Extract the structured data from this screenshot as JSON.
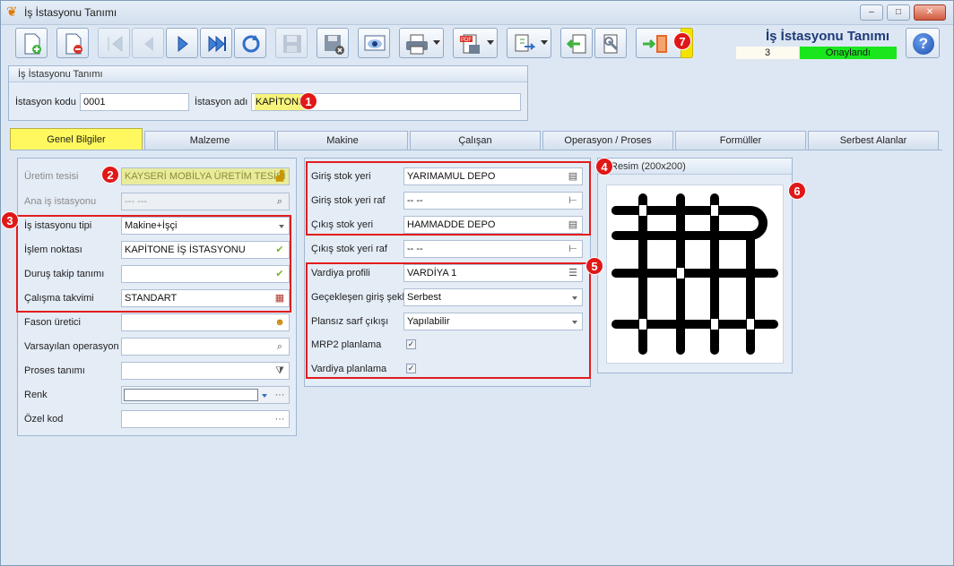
{
  "window": {
    "title": "İş İstasyonu Tanımı",
    "controls": {
      "minimize": "–",
      "maximize": "□",
      "close": "✕"
    }
  },
  "header": {
    "title": "İş İstasyonu Tanımı",
    "record_number": "3",
    "status": "Onaylandı",
    "status_color": "#19e61c"
  },
  "toolbar": {
    "buttons": [
      "new-icon",
      "delete-icon",
      "first-icon",
      "prev-icon",
      "next-icon",
      "last-icon",
      "refresh-icon",
      "save-icon",
      "save-close-icon",
      "preview-icon",
      "print-icon",
      "pdf-icon",
      "export-icon",
      "import-icon",
      "tools-icon",
      "exit-icon"
    ]
  },
  "station": {
    "group_title": "İş İstasyonu Tanımı",
    "code_label": "İstasyon kodu",
    "code_value": "0001",
    "name_label": "İstasyon adı",
    "name_value": "KAPİTONE"
  },
  "tabs": [
    "Genel Bilgiler",
    "Malzeme",
    "Makine",
    "Çalışan",
    "Operasyon / Proses",
    "Formüller",
    "Serbest Alanlar"
  ],
  "general": {
    "uretim_tesisi_label": "Üretim tesisi",
    "uretim_tesisi_value": "KAYSERİ MOBİLYA ÜRETİM TESİSİ",
    "ana_is_label": "Ana iş istasyonu",
    "ana_is_value": "--- ---",
    "tipi_label": "İş istasyonu tipi",
    "tipi_value": "Makine+İşçi",
    "islem_label": "İşlem noktası",
    "islem_value": "KAPİTONE İŞ İSTASYONU",
    "durus_label": "Duruş takip tanımı",
    "durus_value": "",
    "takvim_label": "Çalışma takvimi",
    "takvim_value": "STANDART",
    "fason_label": "Fason üretici",
    "varsayilan_label": "Varsayılan operasyon",
    "proses_label": "Proses tanımı",
    "renk_label": "Renk",
    "ozel_label": "Özel kod"
  },
  "stock": {
    "giris_label": "Giriş stok yeri",
    "giris_value": "YARIMAMUL DEPO",
    "giris_raf_label": "Giriş stok yeri raf",
    "giris_raf_value": "-- --",
    "cikis_label": "Çıkış stok yeri",
    "cikis_value": "HAMMADDE DEPO",
    "cikis_raf_label": "Çıkış stok yeri raf",
    "cikis_raf_value": "-- --",
    "vardiya_label": "Vardiya profili",
    "vardiya_value": "VARDİYA 1",
    "gecikmeli_label": "Geçekleşen giriş şekli",
    "gecikmeli_value": "Serbest",
    "plansiz_label": "Plansız sarf çıkışı",
    "plansiz_value": "Yapılabilir",
    "mrp_label": "MRP2 planlama",
    "mrp_checked": true,
    "vardiya_plan_label": "Vardiya planlama",
    "vardiya_plan_checked": true
  },
  "image_panel": {
    "title": "Resim (200x200)"
  },
  "markers": [
    "1",
    "2",
    "3",
    "4",
    "5",
    "6",
    "7"
  ]
}
